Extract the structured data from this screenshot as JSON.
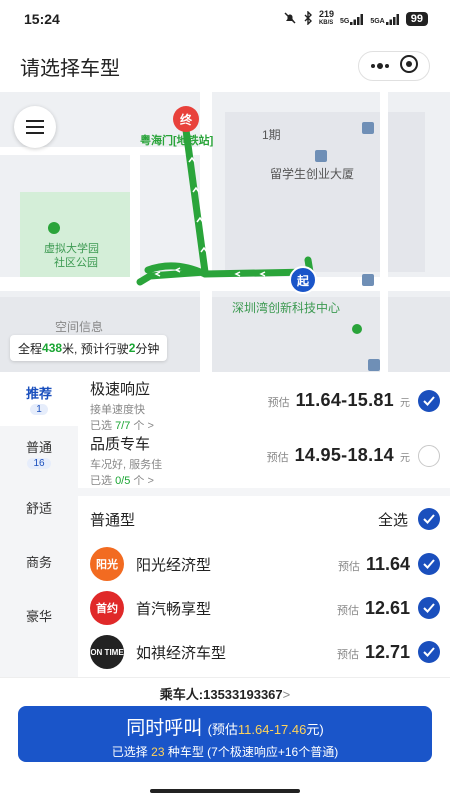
{
  "status_bar": {
    "time": "15:24",
    "net_speed": "219",
    "net_unit": "KB/S",
    "sig1": "5G",
    "sig2": "5GA",
    "battery": "99"
  },
  "header": {
    "title": "请选择车型"
  },
  "map": {
    "pois": {
      "end_marker": "终",
      "start_marker": "起",
      "metro": "粤海门[地铁站]",
      "phase1": "1期",
      "startup": "留学生创业大厦",
      "park": "虚拟大学园\n社区公园",
      "park_l1": "虚拟大学园",
      "park_l2": "社区公园",
      "space_info": "空间信息",
      "innov": "深圳湾创新科技中心"
    },
    "route_info": {
      "prefix": "全程",
      "distance": "438",
      "mid": "米, 预计行驶",
      "minutes": "2",
      "suffix": "分钟"
    }
  },
  "sidebar": {
    "tabs": [
      {
        "label": "推荐",
        "badge": "1"
      },
      {
        "label": "普通",
        "badge": "16"
      },
      {
        "label": "舒适",
        "badge": ""
      },
      {
        "label": "商务",
        "badge": ""
      },
      {
        "label": "豪华",
        "badge": ""
      }
    ]
  },
  "recommend": [
    {
      "name": "极速响应",
      "sub": "接单速度快",
      "sel_prefix": "已选 ",
      "sel_count": "7/7",
      "sel_suffix": " 个 >",
      "est": "预估",
      "price": "11.64-15.81",
      "unit": "元",
      "checked": true
    },
    {
      "name": "品质专车",
      "sub": "车况好, 服务佳",
      "sel_prefix": "已选 ",
      "sel_count": "0/5",
      "sel_suffix": " 个 >",
      "est": "预估",
      "price": "14.95-18.14",
      "unit": "元",
      "checked": false
    }
  ],
  "normal_group": {
    "title": "普通型",
    "select_all": "全选",
    "cars": [
      {
        "name": "阳光经济型",
        "logo": "阳光",
        "logo_color": "#f26b21",
        "est": "预估",
        "price": "11.64"
      },
      {
        "name": "首汽畅享型",
        "logo": "首约",
        "logo_color": "#e02929",
        "est": "预估",
        "price": "12.61"
      },
      {
        "name": "如祺经济车型",
        "logo": "ON TIME",
        "logo_color": "#222222",
        "est": "预估",
        "price": "12.71"
      }
    ]
  },
  "footer": {
    "passenger_label": "乘车人:",
    "passenger_phone": "13533193367",
    "arrow": ">",
    "call_main": "同时呼叫",
    "call_est_prefix": "(预估",
    "call_est_range": "11.64-17.46",
    "call_est_suffix": "元)",
    "sel_prefix": "已选择 ",
    "sel_count": "23",
    "sel_suffix": " 种车型 (7个极速响应+16个普通)"
  },
  "colors": {
    "primary": "#1a55c9",
    "route": "#2aa43a",
    "end_marker": "#e8413b",
    "start_marker": "#1a55c9"
  }
}
